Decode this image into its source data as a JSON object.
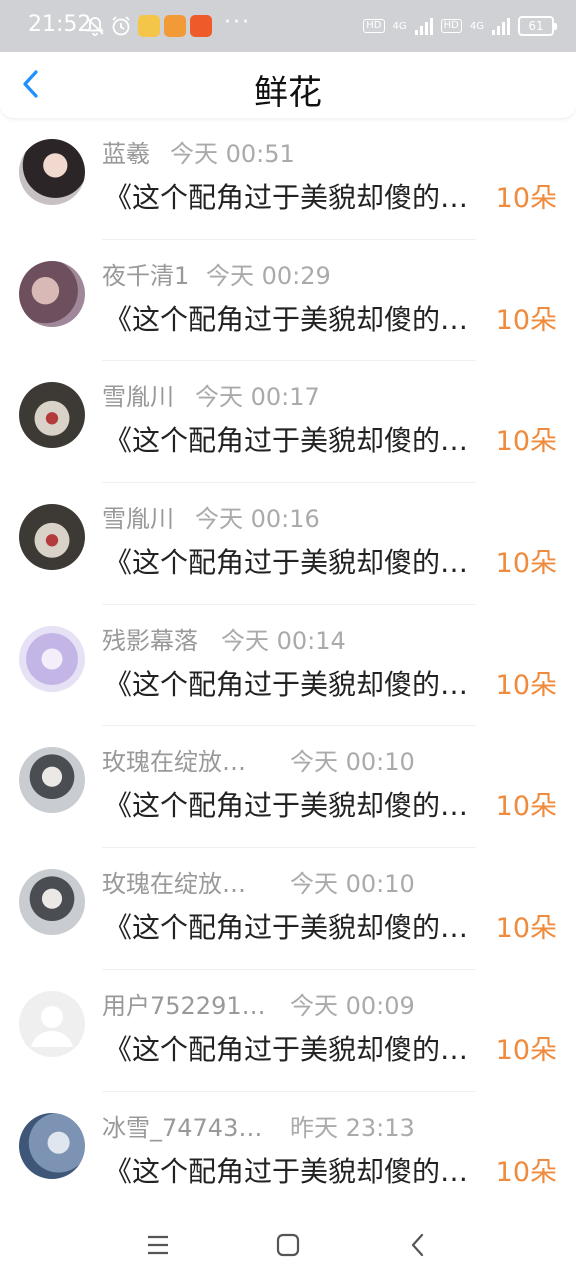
{
  "status_bar": {
    "time": "21:52",
    "indicators": [
      "mute-bell-icon",
      "alarm-icon",
      "app-icon",
      "app-icon",
      "app-icon"
    ],
    "more": "···",
    "sim1_label": "HD",
    "sim1_network": "4G",
    "sim2_label": "HD",
    "sim2_network": "4G",
    "battery": "61"
  },
  "header": {
    "title": "鲜花",
    "back_icon": "chevron-left-icon"
  },
  "records": [
    {
      "name": "蓝羲",
      "time": "今天 00:51",
      "book": "《这个配角过于美貌却傻的…",
      "quantity": "10朵",
      "avatar_color": "#3a3034"
    },
    {
      "name": "夜千清1",
      "time": "今天 00:29",
      "book": "《这个配角过于美貌却傻的…",
      "quantity": "10朵",
      "avatar_color": "#8a6a78"
    },
    {
      "name": "雪胤川",
      "time": "今天 00:17",
      "book": "《这个配角过于美貌却傻的…",
      "quantity": "10朵",
      "avatar_color": "#4d4a45"
    },
    {
      "name": "雪胤川",
      "time": "今天 00:16",
      "book": "《这个配角过于美貌却傻的…",
      "quantity": "10朵",
      "avatar_color": "#4d4a45"
    },
    {
      "name": "残影幕落",
      "time": "今天 00:14",
      "book": "《这个配角过于美貌却傻的…",
      "quantity": "10朵",
      "avatar_color": "#c9bfe8"
    },
    {
      "name": "玫瑰在绽放…",
      "time": "今天 00:10",
      "book": "《这个配角过于美貌却傻的…",
      "quantity": "10朵",
      "avatar_color": "#9da2a6"
    },
    {
      "name": "玫瑰在绽放…",
      "time": "今天 00:10",
      "book": "《这个配角过于美貌却傻的…",
      "quantity": "10朵",
      "avatar_color": "#9da2a6"
    },
    {
      "name": "用户752291…",
      "time": "今天 00:09",
      "book": "《这个配角过于美貌却傻的…",
      "quantity": "10朵",
      "avatar_color": "#eeeeee"
    },
    {
      "name": "冰雪_74743…",
      "time": "昨天 23:13",
      "book": "《这个配角过于美貌却傻的…",
      "quantity": "10朵",
      "avatar_color": "#7f97b8"
    }
  ],
  "accent_color": "#f08a3c",
  "nav_bar": {
    "buttons": [
      "menu-icon",
      "home-square-icon",
      "back-triangle-icon"
    ]
  }
}
